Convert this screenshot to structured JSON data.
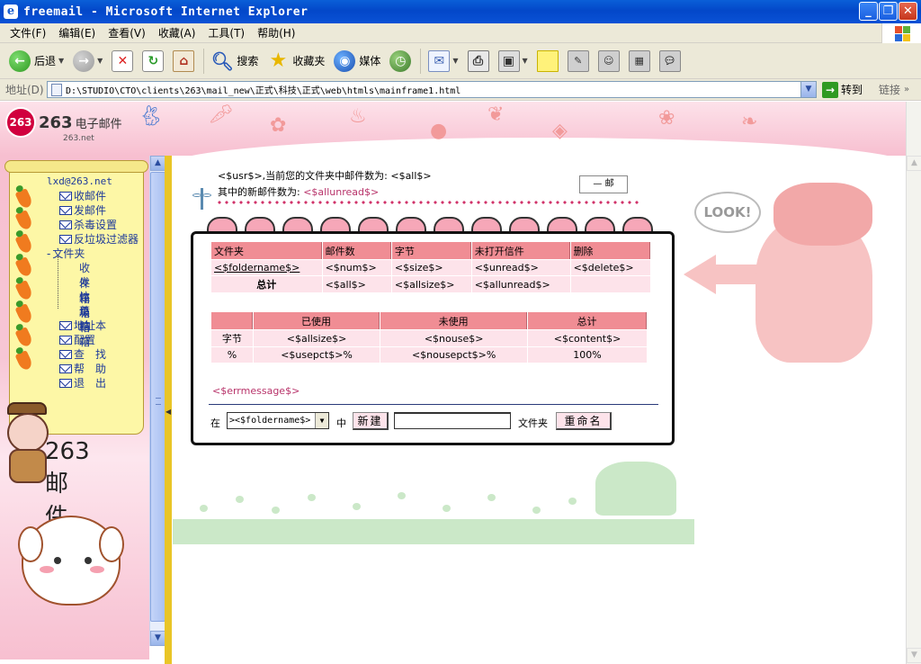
{
  "window": {
    "title": "freemail - Microsoft Internet Explorer",
    "app_icon": "e"
  },
  "menu": [
    "文件(F)",
    "编辑(E)",
    "查看(V)",
    "收藏(A)",
    "工具(T)",
    "帮助(H)"
  ],
  "toolbar": {
    "back": "后退",
    "search": "搜索",
    "favorites": "收藏夹",
    "media": "媒体"
  },
  "address": {
    "label": "地址(D)",
    "url": "D:\\STUDIO\\CTO\\clients\\263\\mail_new\\正式\\科技\\正式\\web\\htmls\\mainframe1.html",
    "go": "转到",
    "links": "链接"
  },
  "logo": {
    "badge": "263",
    "brand": "263",
    "sub": "电子邮件",
    "net": "263.net"
  },
  "sidebar": {
    "user": "lxd@263.net",
    "items": [
      "收邮件",
      "发邮件",
      "杀毒设置",
      "反垃圾过滤器"
    ],
    "folder": "文件夹",
    "subfolders": [
      "收件箱",
      "发件箱",
      "垃圾箱",
      "草稿箱"
    ],
    "items2": [
      "地址本",
      "配置",
      "查　找",
      "帮　助",
      "退　出"
    ],
    "mascot_text": "263邮件"
  },
  "main": {
    "greeting": "<$usr$>,当前您的文件夹中邮件数为: <$all$>",
    "new_count_label": "其中的新邮件数为:",
    "new_count_var": "<$allunread$>",
    "small_box": "— 邮",
    "folder_table": {
      "headers": [
        "文件夹",
        "邮件数",
        "字节",
        "未打开信件",
        "删除"
      ],
      "row": [
        "<$foldername$>",
        "<$num$>",
        "<$size$>",
        "<$unread$>",
        "<$delete$>"
      ],
      "total": [
        "总计",
        "<$all$>",
        "<$allsize$>",
        "<$allunread$>",
        ""
      ]
    },
    "usage_table": {
      "headers": [
        "",
        "已使用",
        "未使用",
        "总计"
      ],
      "rows": [
        [
          "字节",
          "<$allsize$>",
          "<$nouse$>",
          "<$content$>"
        ],
        [
          "%",
          "<$usepct$>%",
          "<$nousepct$>%",
          "100%"
        ]
      ]
    },
    "errmessage": "<$errmessage$>",
    "bottom": {
      "zai": "在",
      "select_value": "><$foldername$>",
      "zhong": "中",
      "new_button": "新建",
      "folder_label": "文件夹",
      "rename_button": "重命名"
    }
  },
  "decor": {
    "look": "LOOK!"
  }
}
